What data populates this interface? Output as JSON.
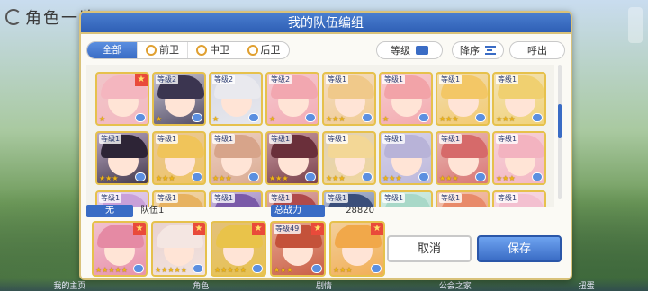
{
  "background": {
    "title": "角色一览"
  },
  "modal": {
    "title": "我的队伍编组"
  },
  "tabs": [
    {
      "label": "全部",
      "icon": null,
      "active": true
    },
    {
      "label": "前卫",
      "icon": "position-front-icon",
      "active": false
    },
    {
      "label": "中卫",
      "icon": "position-middle-icon",
      "active": false
    },
    {
      "label": "后卫",
      "icon": "position-back-icon",
      "active": false
    }
  ],
  "toolbar": {
    "level_label": "等级",
    "order_label": "降序",
    "call_label": "呼出"
  },
  "roster": [
    {
      "level": "",
      "stars": 1,
      "hair": "#f4b6bf",
      "bg": "#f0c6c9",
      "badge": true
    },
    {
      "level": "等级2",
      "stars": 1,
      "hair": "#3b3550",
      "bg": "#c9c5d4",
      "badge": false
    },
    {
      "level": "等级2",
      "stars": 1,
      "hair": "#e9e9ee",
      "bg": "#d8dbe6",
      "badge": false
    },
    {
      "level": "等级2",
      "stars": 1,
      "hair": "#f2a7b0",
      "bg": "#f5c8cf",
      "badge": false
    },
    {
      "level": "等级1",
      "stars": 3,
      "hair": "#f0c98a",
      "bg": "#f4dcc2",
      "badge": false
    },
    {
      "level": "等级1",
      "stars": 1,
      "hair": "#f2a3a8",
      "bg": "#f7cdd0",
      "badge": false
    },
    {
      "level": "等级1",
      "stars": 3,
      "hair": "#f3c766",
      "bg": "#f2ddb0",
      "badge": false
    },
    {
      "level": "等级1",
      "stars": 3,
      "hair": "#f0d070",
      "bg": "#f3e2b5",
      "badge": false
    },
    {
      "level": "等级1",
      "stars": 3,
      "hair": "#2d2436",
      "bg": "#b9a7c2",
      "badge": false
    },
    {
      "level": "等级1",
      "stars": 3,
      "hair": "#f0c45a",
      "bg": "#e9c89a",
      "badge": false
    },
    {
      "level": "等级1",
      "stars": 3,
      "hair": "#d7a48a",
      "bg": "#edd0c2",
      "badge": false
    },
    {
      "level": "等级1",
      "stars": 3,
      "hair": "#6a2f3a",
      "bg": "#c99aa2",
      "badge": false
    },
    {
      "level": "等级1",
      "stars": 3,
      "hair": "#f3d796",
      "bg": "#e1d2b8",
      "badge": false
    },
    {
      "level": "等级1",
      "stars": 3,
      "hair": "#b8b3d8",
      "bg": "#d6d2ea",
      "badge": false
    },
    {
      "level": "等级1",
      "stars": 3,
      "hair": "#d66a6a",
      "bg": "#e9b8b3",
      "badge": false
    },
    {
      "level": "等级1",
      "stars": 3,
      "hair": "#f3b3c0",
      "bg": "#f6d1d8",
      "badge": false
    },
    {
      "level": "等级1",
      "stars": 1,
      "hair": "#c9a0d8",
      "bg": "#e3d0ec",
      "badge": false
    },
    {
      "level": "等级1",
      "stars": 1,
      "hair": "#e7b260",
      "bg": "#f1d8b0",
      "badge": false
    },
    {
      "level": "等级1",
      "stars": 1,
      "hair": "#7a5aa8",
      "bg": "#c8b8dc",
      "badge": false
    },
    {
      "level": "等级1",
      "stars": 1,
      "hair": "#b04a4a",
      "bg": "#dfb0aa",
      "badge": false
    },
    {
      "level": "等级1",
      "stars": 1,
      "hair": "#3a4e7a",
      "bg": "#b7c0d8",
      "badge": false
    },
    {
      "level": "等级1",
      "stars": 1,
      "hair": "#a8d8c8",
      "bg": "#d2ece4",
      "badge": false
    },
    {
      "level": "等级1",
      "stars": 1,
      "hair": "#e88a6a",
      "bg": "#f2c4b0",
      "badge": false
    },
    {
      "level": "等级1",
      "stars": 1,
      "hair": "#f3c0d0",
      "bg": "#f6d8e2",
      "badge": false
    }
  ],
  "team_bar": {
    "team_number": "无",
    "team_name": "队伍1",
    "power_label": "总战力",
    "power_value": "28820"
  },
  "team": [
    {
      "level": "",
      "stars": 5,
      "hair": "#e58aa4",
      "bg": "#f2c0cf",
      "badge": true
    },
    {
      "level": "",
      "stars": 5,
      "hair": "#f4e6e2",
      "bg": "#e8d2d0",
      "badge": true
    },
    {
      "level": "",
      "stars": 5,
      "hair": "#e9c34a",
      "bg": "#e3c17a",
      "badge": true
    },
    {
      "level": "等级49",
      "stars": 3,
      "hair": "#c4523a",
      "bg": "#e6a58f",
      "badge": true
    },
    {
      "level": "",
      "stars": 3,
      "hair": "#f1a84a",
      "bg": "#f3cf9a",
      "badge": true
    }
  ],
  "buttons": {
    "cancel": "取消",
    "save": "保存"
  },
  "bottom_tabs": [
    "我的主页",
    "角色",
    "剧情",
    "公会之家",
    "扭蛋"
  ]
}
